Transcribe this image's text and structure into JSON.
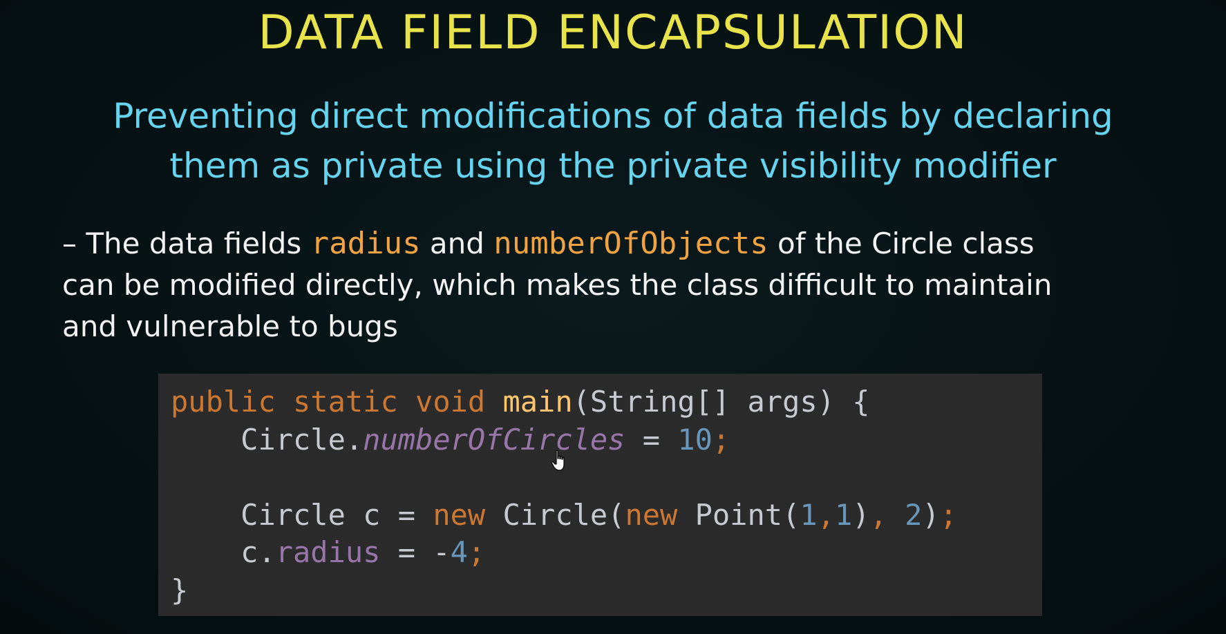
{
  "slide": {
    "title": "DATA FIELD ENCAPSULATION",
    "subtitle_line1": "Preventing direct modifications of data fields by declaring",
    "subtitle_line2": "them as private using the private visibility modifier",
    "bullet": {
      "prefix": "– The data fields ",
      "field1": "radius",
      "and": " and ",
      "field2": "numberOfObjects",
      "suffix1": " of the Circle class",
      "line2": "can be modified directly, which makes the class difficult to maintain",
      "line3": "and vulnerable to bugs"
    },
    "code": {
      "l1_kw1": "public",
      "l1_kw2": "static",
      "l1_kw3": "void",
      "l1_fn": "main",
      "l1_rest": "(String[] args) {",
      "l2_obj": "Circle.",
      "l2_field": "numberOfCircles",
      "l2_eq": " = ",
      "l2_num": "10",
      "l2_semi": ";",
      "l4_a": "Circle c = ",
      "l4_new1": "new",
      "l4_b": " Circle(",
      "l4_new2": "new",
      "l4_c": " Point(",
      "l4_n1": "1",
      "l4_comma1": ",",
      "l4_n2": "1",
      "l4_d": ")",
      "l4_comma2": ",",
      "l4_n3": " 2",
      "l4_e": ")",
      "l4_semi": ";",
      "l5_obj": "c.",
      "l5_field": "radius",
      "l5_eq": " = -",
      "l5_num": "4",
      "l5_semi": ";",
      "l6": "}"
    },
    "colors": {
      "title": "#e8e34b",
      "subtitle": "#66d4ee",
      "body_text": "#f2f2f2",
      "inline_code": "#f0a340",
      "code_bg": "#2b2b2b",
      "keyword": "#cc7832",
      "method": "#ffc66d",
      "number": "#6897bb",
      "field": "#9876aa"
    },
    "icons": [
      "hand-cursor-icon"
    ]
  }
}
